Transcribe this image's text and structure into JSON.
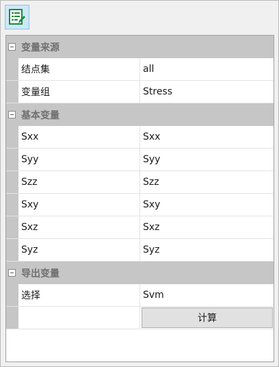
{
  "toolbar": {
    "icon": "property-sheet-edit-icon"
  },
  "categories": [
    {
      "title": "变量来源",
      "rows": [
        {
          "name": "结点集",
          "value": "all"
        },
        {
          "name": "变量组",
          "value": "Stress"
        }
      ]
    },
    {
      "title": "基本变量",
      "rows": [
        {
          "name": "Sxx",
          "value": "Sxx"
        },
        {
          "name": "Syy",
          "value": "Syy"
        },
        {
          "name": "Szz",
          "value": "Szz"
        },
        {
          "name": "Sxy",
          "value": "Sxy"
        },
        {
          "name": "Sxz",
          "value": "Sxz"
        },
        {
          "name": "Syz",
          "value": "Syz"
        }
      ]
    },
    {
      "title": "导出变量",
      "rows": [
        {
          "name": "选择",
          "value": "Svm"
        }
      ],
      "button_label": "计算"
    }
  ],
  "colors": {
    "category_bg": "#c6c6c6",
    "icon_green": "#1b8a3c",
    "toolbar_button_bg": "#cde8f8"
  }
}
